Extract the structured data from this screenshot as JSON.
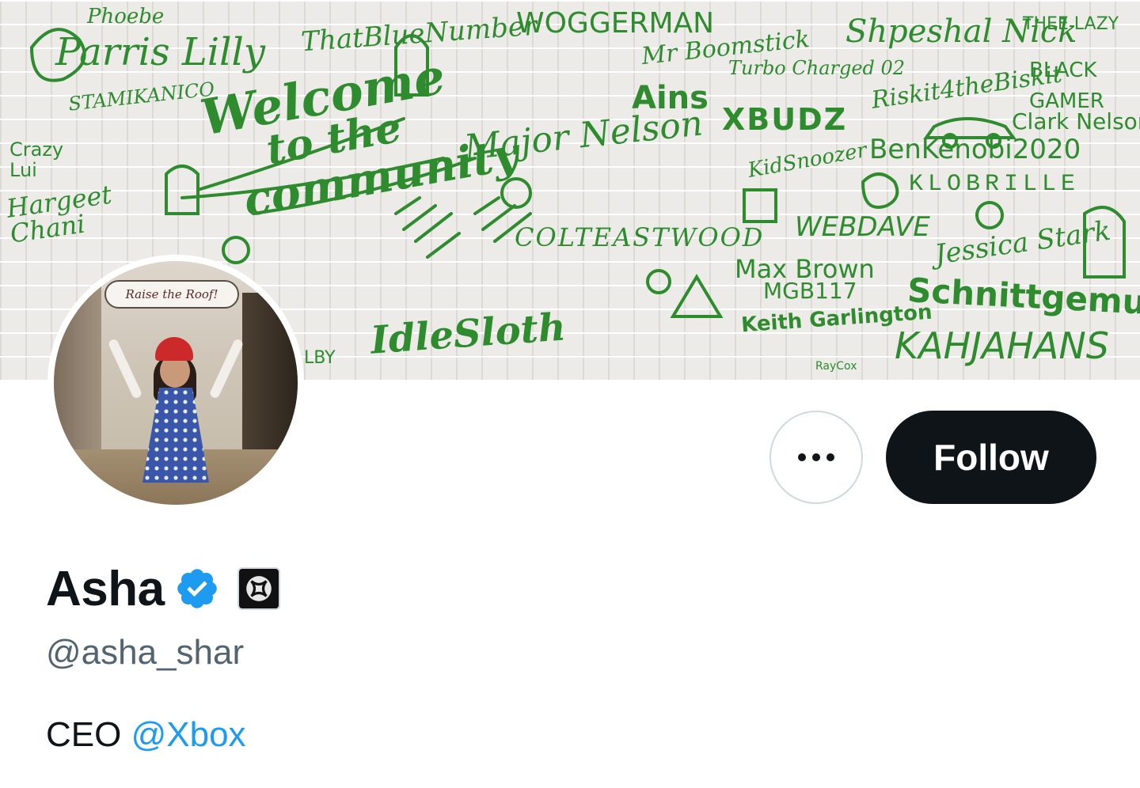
{
  "banner": {
    "signatures": {
      "welcome_line1": "Welcome",
      "welcome_line2": "to the",
      "welcome_line3": "community",
      "phoebe": "Phoebe",
      "parris": "Parris Lilly",
      "bluenumber": "ThatBlueNumber",
      "woggerman": "WOGGERMAN",
      "boomstick": "Mr Boomstick",
      "shpeshal": "Shpeshal Nick",
      "thee_lazy": "THEE LAZY",
      "black_gamer": "BLACK GAMER",
      "turbo": "Turbo Charged 02",
      "stamikanico": "STAMIKANICO",
      "ains": "Ains",
      "xbudz": "XBUDZ",
      "riskit": "Riskit4theBiskit",
      "clark": "Clark Nelson",
      "crazy": "Crazy Lui",
      "hargeet": "Hargeet Chani",
      "maja": "Major Nelson",
      "benkenobi": "BenKenobi2020",
      "klobrille": "KLOBRILLE",
      "kidsnoozer": "KidSnoozer",
      "webdave": "WEBDAVE",
      "jessica": "Jessica Stark",
      "colteastwood": "COLTEASTWOOD",
      "maxbrown": "Max Brown",
      "mgb": "MGB117",
      "keith": "Keith Garlington",
      "schnitt": "Schnittgemuese",
      "kahjahans": "KAHJAHANS",
      "idlesloth": "IdleSloth",
      "raycox": "RayCox",
      "wasley": "LBY"
    }
  },
  "avatar": {
    "speech_bubble": "Raise the Roof!"
  },
  "actions": {
    "more_label": "More",
    "follow_label": "Follow"
  },
  "profile": {
    "display_name": "Asha",
    "handle": "@asha_shar",
    "bio_prefix": "CEO ",
    "bio_mention": "@Xbox"
  },
  "colors": {
    "signature_green": "#2e8b2e",
    "follow_bg": "#0f1419",
    "verified_blue": "#1d9bf0",
    "handle_gray": "#536471",
    "link_blue": "#1d9bf0"
  },
  "icons": {
    "verified": "verified-badge-icon",
    "affiliate": "xbox-logo-icon",
    "more": "more-horizontal-icon"
  }
}
